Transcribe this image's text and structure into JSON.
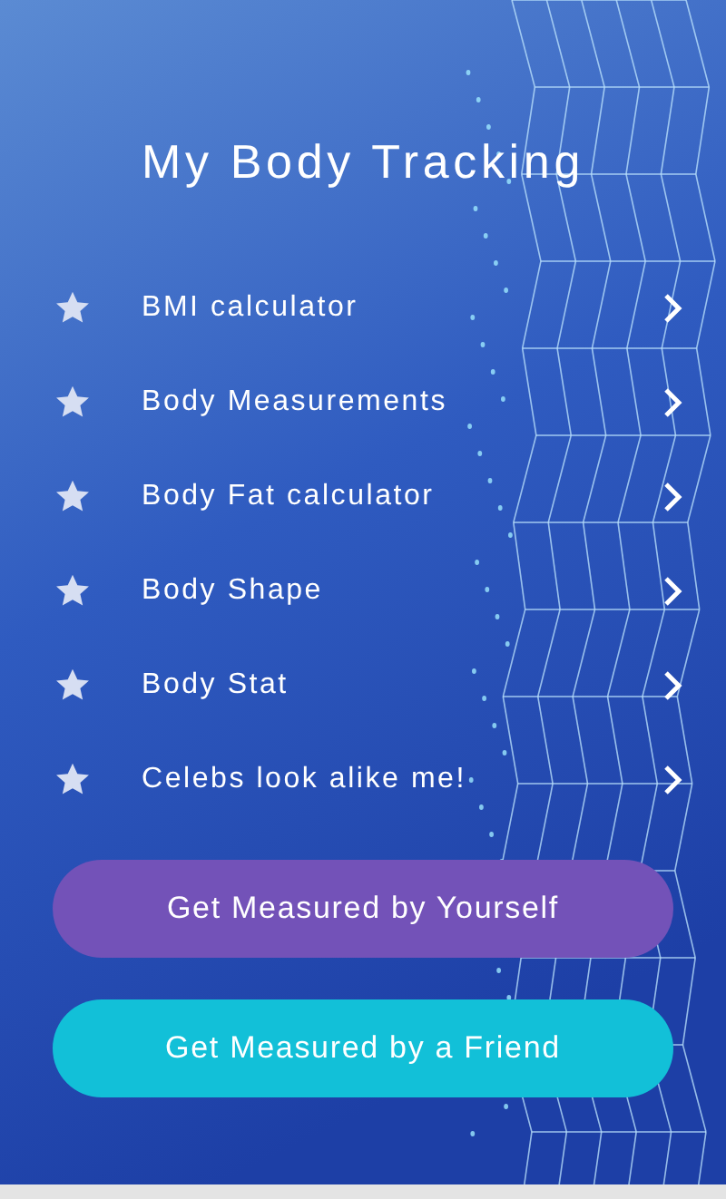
{
  "title": "My Body Tracking",
  "menu_items": [
    {
      "label": "BMI calculator"
    },
    {
      "label": "Body Measurements"
    },
    {
      "label": "Body Fat calculator"
    },
    {
      "label": "Body Shape"
    },
    {
      "label": "Body Stat"
    },
    {
      "label": "Celebs look alike me!"
    }
  ],
  "buttons": [
    {
      "label": "Get Measured by Yourself",
      "color": "#7352b8"
    },
    {
      "label": "Get Measured by a Friend",
      "color": "#12c0d8"
    }
  ]
}
